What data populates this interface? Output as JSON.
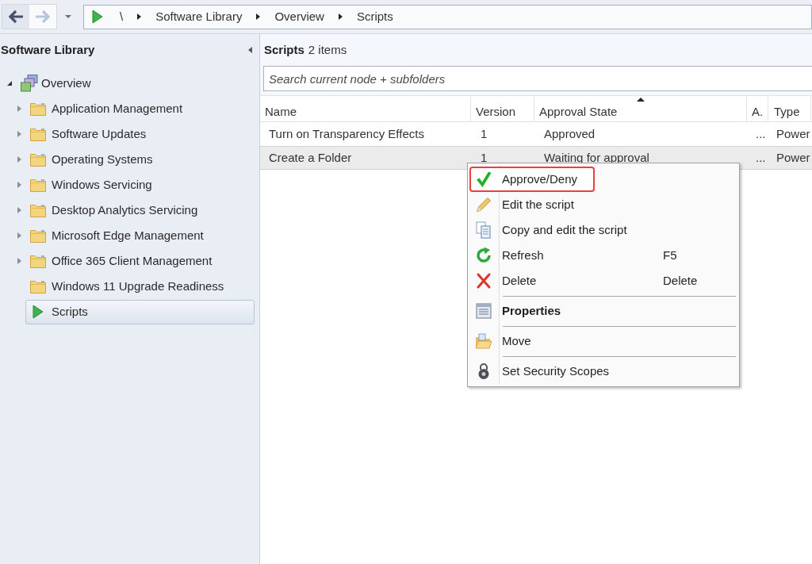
{
  "toolbar": {
    "back_button": {
      "disabled": false
    },
    "forward_button": {
      "disabled": true
    },
    "breadcrumb": [
      {
        "label": "\\"
      },
      {
        "label": "Software Library"
      },
      {
        "label": "Overview"
      },
      {
        "label": "Scripts"
      }
    ]
  },
  "navigation_pane": {
    "title": "Software Library",
    "tree": [
      {
        "label": "Overview",
        "kind": "overview",
        "expandable": true,
        "expanded": true,
        "selected": false,
        "children": [
          {
            "label": "Application Management",
            "kind": "folder",
            "expandable": true,
            "expanded": false,
            "selected": false
          },
          {
            "label": "Software Updates",
            "kind": "folder",
            "expandable": true,
            "expanded": false,
            "selected": false
          },
          {
            "label": "Operating Systems",
            "kind": "folder",
            "expandable": true,
            "expanded": false,
            "selected": false
          },
          {
            "label": "Windows Servicing",
            "kind": "folder",
            "expandable": true,
            "expanded": false,
            "selected": false
          },
          {
            "label": "Desktop Analytics Servicing",
            "kind": "folder",
            "expandable": true,
            "expanded": false,
            "selected": false
          },
          {
            "label": "Microsoft Edge Management",
            "kind": "folder",
            "expandable": true,
            "expanded": false,
            "selected": false
          },
          {
            "label": "Office 365 Client Management",
            "kind": "folder",
            "expandable": true,
            "expanded": false,
            "selected": false
          },
          {
            "label": "Windows 11 Upgrade Readiness",
            "kind": "folder",
            "expandable": false,
            "selected": false
          },
          {
            "label": "Scripts",
            "kind": "scripts",
            "expandable": false,
            "selected": true
          }
        ]
      }
    ]
  },
  "list": {
    "title": "Scripts",
    "count": "2 items",
    "search": {
      "placeholder": "Search current node + subfolders"
    },
    "table": {
      "columns": [
        {
          "label": "Name",
          "sorted": false
        },
        {
          "label": "Version",
          "sorted": false
        },
        {
          "label": "Approval State",
          "sorted": true
        },
        {
          "label": "A.",
          "sorted": false
        },
        {
          "label": "Type",
          "sorted": false
        }
      ],
      "rows": [
        {
          "cells": [
            "Turn on Transparency Effects",
            "1",
            "Approved",
            "...",
            "Power"
          ],
          "selected": false
        },
        {
          "cells": [
            "Create a Folder",
            "1",
            "Waiting for approval",
            "...",
            "Power"
          ],
          "selected": true
        }
      ]
    }
  },
  "context_menu": {
    "groups": [
      {
        "items": [
          {
            "label": "Approve/Deny",
            "highlighted": true,
            "default": false
          },
          {
            "label": "Edit the script",
            "highlighted": false,
            "default": false
          },
          {
            "label": "Copy and edit the script",
            "highlighted": false,
            "default": false
          },
          {
            "label": "Refresh",
            "shortcut": "F5",
            "highlighted": false,
            "default": false
          },
          {
            "label": "Delete",
            "shortcut": "Delete",
            "highlighted": false,
            "default": false
          }
        ]
      },
      {
        "items": [
          {
            "label": "Properties",
            "highlighted": false,
            "default": true
          }
        ]
      },
      {
        "items": [
          {
            "label": "Move",
            "highlighted": false,
            "default": false
          }
        ]
      },
      {
        "items": [
          {
            "label": "Set Security Scopes",
            "highlighted": false,
            "default": false
          }
        ]
      }
    ]
  }
}
